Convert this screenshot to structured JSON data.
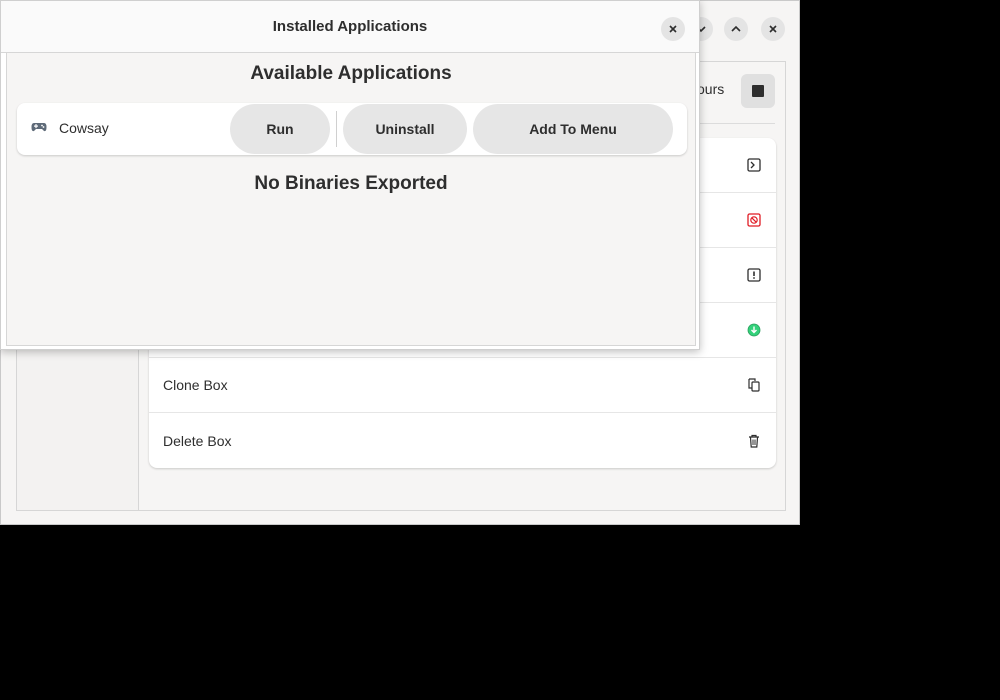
{
  "main_window": {
    "partial_header_text": "ours",
    "window_buttons": [
      "chevron-down-icon",
      "chevron-up-icon",
      "close-icon"
    ],
    "actions": [
      {
        "label": "",
        "icon": "terminal-icon",
        "color": "#2e2e2e"
      },
      {
        "label": "",
        "icon": "stop-circle-icon",
        "color": "#e01b24"
      },
      {
        "label": "",
        "icon": "alert-icon",
        "color": "#2e2e2e"
      },
      {
        "label": "",
        "icon": "upgrade-icon",
        "color": "#33d17a"
      },
      {
        "label": "Clone Box",
        "icon": "clone-icon",
        "color": "#2e2e2e"
      },
      {
        "label": "Delete Box",
        "icon": "trash-icon",
        "color": "#2e2e2e"
      }
    ]
  },
  "dialog": {
    "title": "Installed Applications",
    "section_title": "Available Applications",
    "apps": [
      {
        "name": "Cowsay",
        "icon": "gamepad-icon",
        "run_label": "Run",
        "uninstall_label": "Uninstall",
        "add_menu_label": "Add To Menu"
      }
    ],
    "empty_binaries": "No Binaries Exported"
  },
  "colors": {
    "background": "#000000",
    "window_bg": "#f6f5f4",
    "card_bg": "#ffffff",
    "button_bg": "#e6e6e6",
    "danger": "#e01b24",
    "success": "#33d17a"
  }
}
